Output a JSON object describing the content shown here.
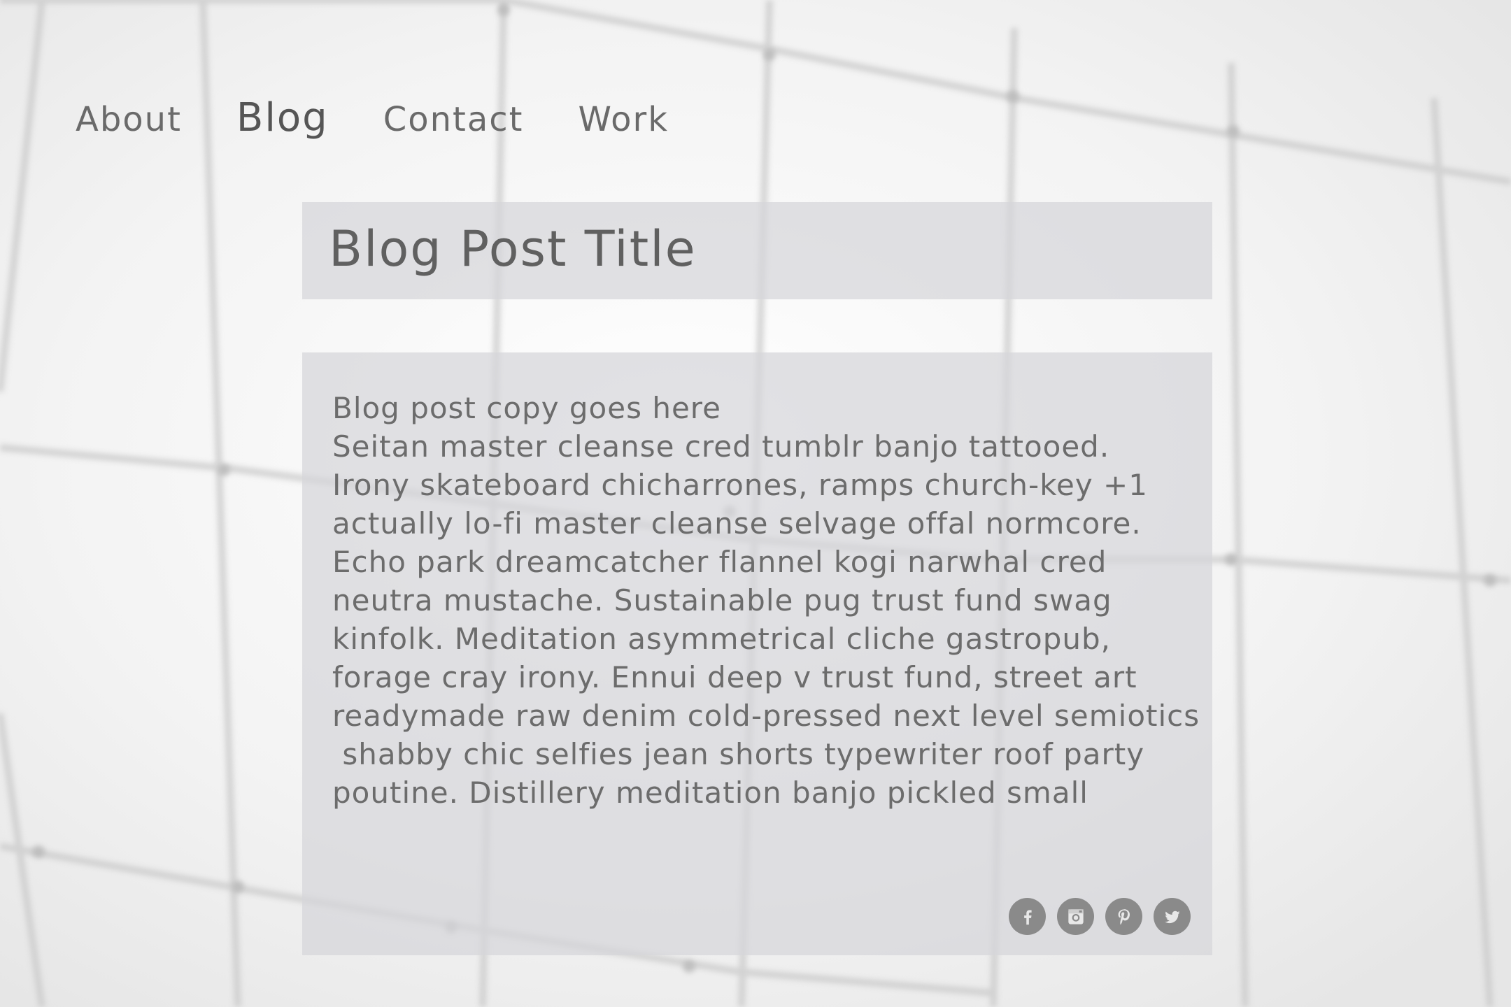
{
  "nav": {
    "items": [
      {
        "label": "About",
        "active": false
      },
      {
        "label": "Blog",
        "active": true
      },
      {
        "label": "Contact",
        "active": false
      },
      {
        "label": "Work",
        "active": false
      }
    ]
  },
  "post": {
    "title": "Blog Post Title",
    "lines": [
      "Blog post copy goes here",
      "Seitan master cleanse cred tumblr banjo tattooed.",
      "Irony skateboard chicharrones, ramps church-key +1",
      "actually lo-fi master cleanse selvage offal normcore.",
      "Echo park dreamcatcher flannel kogi narwhal cred",
      "neutra mustache. Sustainable pug trust fund swag",
      "kinfolk. Meditation asymmetrical cliche gastropub,",
      "forage cray irony. Ennui deep v trust fund, street art",
      "readymade raw denim cold-pressed next level semiotics",
      " shabby chic selfies jean shorts typewriter roof party",
      "poutine. Distillery meditation banjo pickled small"
    ]
  },
  "social": {
    "icons": [
      "facebook-icon",
      "instagram-icon",
      "pinterest-icon",
      "twitter-icon"
    ]
  },
  "colors": {
    "background": "#f4f4f4",
    "panel": "#d6d6da",
    "text": "#6c6c6c",
    "social_icon": "#8a8a8a"
  }
}
